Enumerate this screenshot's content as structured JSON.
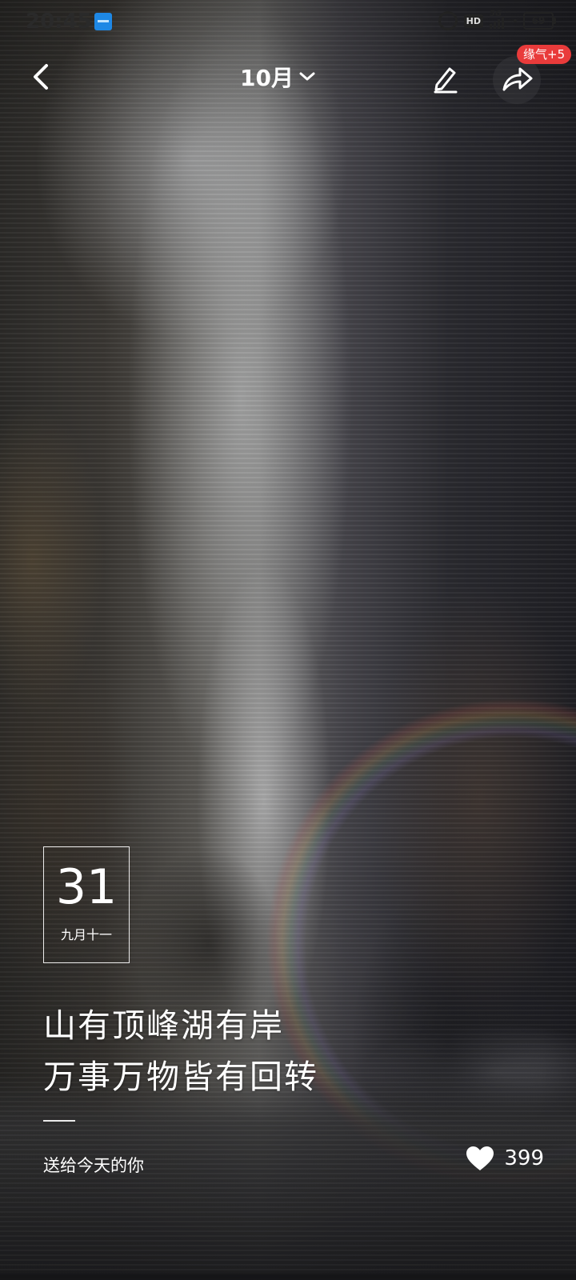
{
  "status_bar": {
    "time": "20:45",
    "network": "5G",
    "hd": "HD",
    "battery": "69"
  },
  "header": {
    "month": "10月",
    "badge": "缘气+5"
  },
  "icons": {
    "back": "chevron-left-icon",
    "dropdown": "chevron-down-icon",
    "edit": "pencil-icon",
    "share": "share-arrow-icon",
    "like": "heart-icon"
  },
  "card": {
    "day": "31",
    "lunar": "九月十一"
  },
  "quote": {
    "lines": [
      "山有顶峰湖有岸",
      "万事万物皆有回转"
    ]
  },
  "footer": {
    "subtitle": "送给今天的你",
    "likes": "399"
  },
  "colors": {
    "badge": "#e93b3b",
    "text": "#ffffff"
  }
}
